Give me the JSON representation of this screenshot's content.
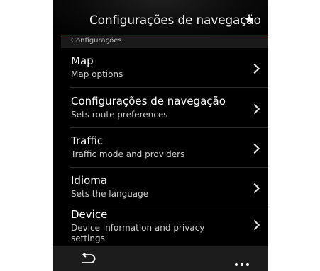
{
  "header": {
    "title": "Configurações de navegação",
    "star_icon": "star-icon"
  },
  "section": {
    "label": "Configurações"
  },
  "menu": {
    "items": [
      {
        "title": "Map",
        "subtitle": "Map options"
      },
      {
        "title": "Configurações de navegação",
        "subtitle": "Sets route preferences"
      },
      {
        "title": "Traffic",
        "subtitle": "Traffic mode and providers"
      },
      {
        "title": "Idioma",
        "subtitle": "Sets the language"
      },
      {
        "title": "Device",
        "subtitle": "Device information and privacy settings"
      }
    ],
    "chevron_icon": "chevron-right-icon"
  },
  "bottom_bar": {
    "back_icon": "back-arrow-icon",
    "more_icon": "more-dots-icon"
  },
  "colors": {
    "background": "#000000",
    "accent_line": "#a8431f",
    "section_bar": "#1a1a1a",
    "bottom_bar": "#1c1c1c"
  }
}
